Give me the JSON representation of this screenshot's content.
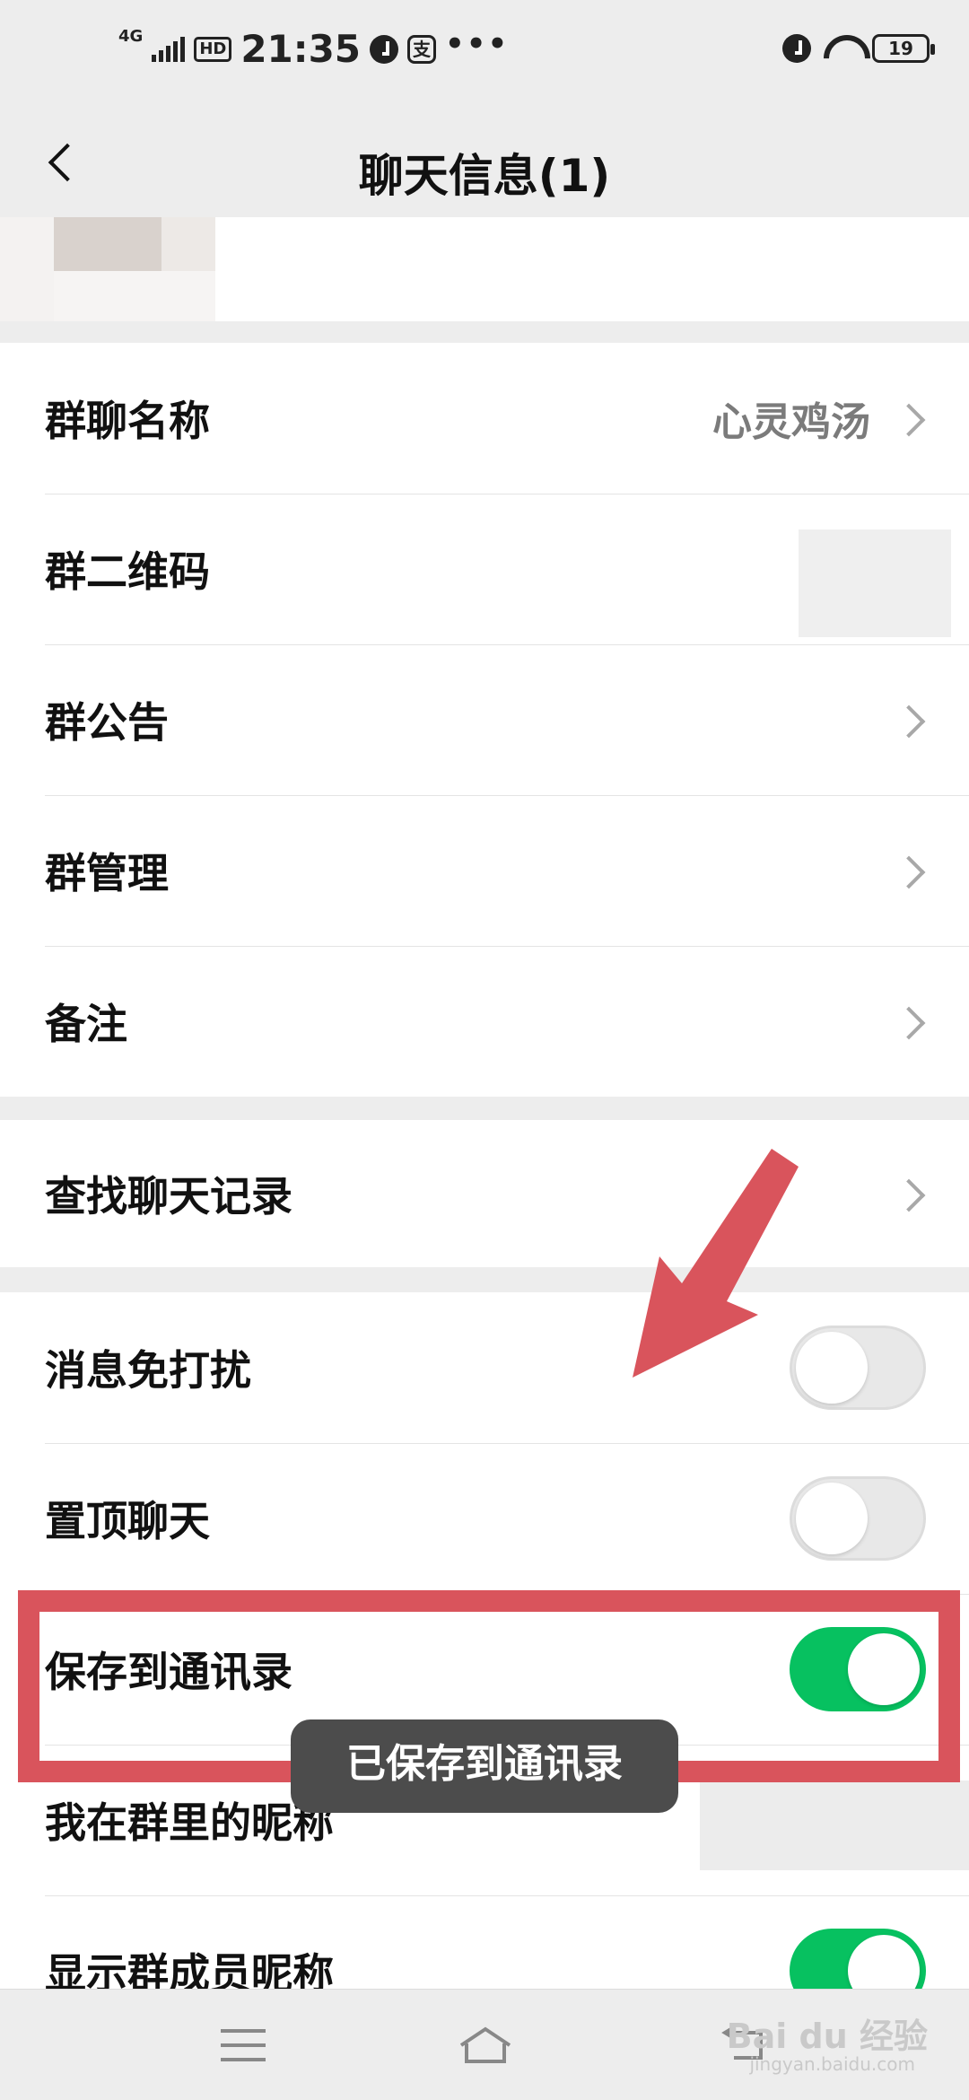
{
  "status_bar": {
    "network": "4G",
    "hd": "HD",
    "time": "21:35",
    "pay_glyph": "支",
    "more": "•••",
    "battery": "19",
    "icons": [
      "signal-icon",
      "alarm-icon",
      "wifi-icon",
      "battery-icon"
    ]
  },
  "navbar": {
    "title": "聊天信息(1)"
  },
  "group1": {
    "items": [
      {
        "label": "群聊名称",
        "value": "心灵鸡汤"
      },
      {
        "label": "群二维码"
      },
      {
        "label": "群公告"
      },
      {
        "label": "群管理"
      },
      {
        "label": "备注"
      }
    ]
  },
  "group2": {
    "items": [
      {
        "label": "查找聊天记录"
      }
    ]
  },
  "group3": {
    "items": [
      {
        "label": "消息免打扰",
        "toggle": false
      },
      {
        "label": "置顶聊天",
        "toggle": false
      },
      {
        "label": "保存到通讯录",
        "toggle": true
      },
      {
        "label": "我在群里的昵称"
      },
      {
        "label": "显示群成员昵称",
        "toggle": true
      }
    ]
  },
  "toast": {
    "text": "已保存到通讯录"
  },
  "watermark": {
    "brand": "Bai du 经验",
    "url": "jingyan.baidu.com"
  },
  "colors": {
    "accent_green": "#07c160",
    "annotation_red": "#d9545c",
    "background": "#ededed"
  }
}
